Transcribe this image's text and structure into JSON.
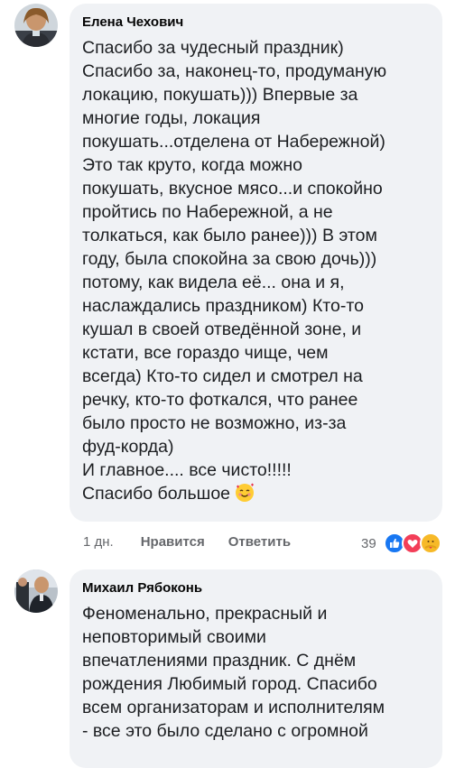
{
  "comments": [
    {
      "author": "Елена Чехович",
      "lines": [
        "Спасибо за чудесный праздник)",
        "Спасибо за, наконец-то,  продуманую",
        "локацию, покушать))) Впервые за",
        "многие годы, локация",
        "покушать...отделена от Набережной)",
        "Это так круто, когда можно",
        "покушать,  вкусное мясо...и спокойно",
        "пройтись по Набережной,  а не",
        "толкаться, как было ранее))) В этом",
        "году, была спокойна за свою дочь)))",
        "потому, как видела её... она и я,",
        "наслаждались праздником) Кто-то",
        "кушал в своей отведённой зоне, и",
        "кстати,  все гораздо чище, чем",
        "всегда) Кто-то сидел и смотрел на",
        "речку, кто-то фоткался, что ранее",
        "было просто не возможно, из-за",
        "фуд-корда)",
        "И главное.... все чисто!!!!!",
        "Спасибо большое"
      ],
      "time": "1 дн.",
      "like_label": "Нравится",
      "reply_label": "Ответить",
      "reaction_count": "39"
    },
    {
      "author": "Михаил Рябоконь",
      "lines": [
        "Феноменально, прекрасный и",
        "неповторимый своими",
        "впечатлениями праздник. С днём",
        "рождения Любимый город. Спасибо",
        "всем организаторам и исполнителям",
        "- все это было сделано с огромной"
      ]
    }
  ],
  "icons": {
    "emoji_end": "smiling-face-with-hearts-icon",
    "reaction_like": "like-reaction-icon",
    "reaction_love": "love-reaction-icon",
    "reaction_care": "care-reaction-icon"
  },
  "colors": {
    "bubble": "#f0f2f5",
    "like_blue": "#1877f2",
    "love_red": "#f33e58"
  }
}
